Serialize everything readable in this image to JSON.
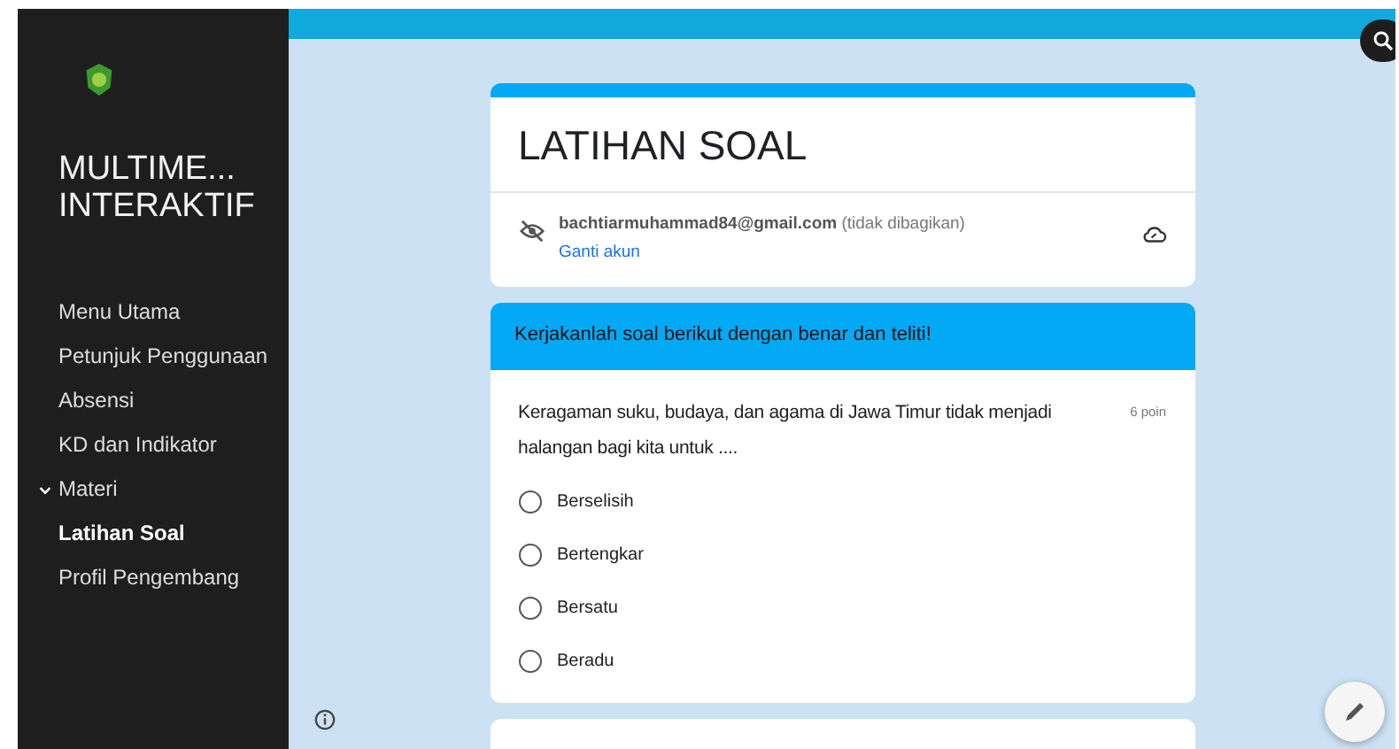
{
  "sidebar": {
    "title": "MULTIME... INTERAKTIF",
    "items": [
      {
        "label": "Menu Utama",
        "selected": false
      },
      {
        "label": "Petunjuk Penggunaan",
        "selected": false
      },
      {
        "label": "Absensi",
        "selected": false
      },
      {
        "label": "KD dan Indikator",
        "selected": false
      },
      {
        "label": "Materi",
        "selected": false,
        "expanded": false
      },
      {
        "label": "Latihan Soal",
        "selected": true
      },
      {
        "label": "Profil Pengembang",
        "selected": false
      }
    ]
  },
  "form": {
    "title": "LATIHAN SOAL",
    "email": "bachtiarmuhammad84@gmail.com",
    "email_note": "(tidak dibagikan)",
    "switch_account": "Ganti akun",
    "section_header": "Kerjakanlah soal berikut dengan benar dan teliti!",
    "question": {
      "text": "Keragaman suku, budaya, dan agama di Jawa Timur tidak menjadi halangan bagi kita untuk ....",
      "points": "6 poin",
      "options": [
        {
          "label": "Berselisih",
          "selected": false
        },
        {
          "label": "Bertengkar",
          "selected": false
        },
        {
          "label": "Bersatu",
          "selected": false
        },
        {
          "label": "Beradu",
          "selected": false
        }
      ]
    }
  }
}
